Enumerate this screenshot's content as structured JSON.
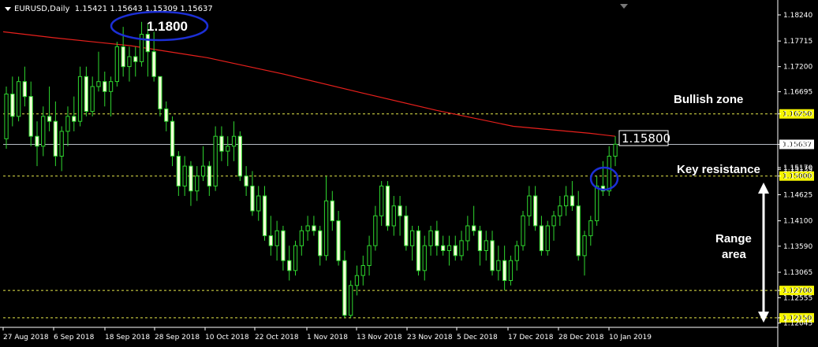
{
  "header": {
    "symbol_label": "EURUSD,Daily",
    "ohlc": "1.15421 1.15643 1.15309 1.15637"
  },
  "chart_data": {
    "type": "candlestick",
    "price_axis_ticks": [
      "1.18240",
      "1.17715",
      "1.17200",
      "1.16695",
      "1.16250",
      "1.15170",
      "1.15637",
      "1.15135",
      "1.15000",
      "1.14625",
      "1.14100",
      "1.13590",
      "1.13065",
      "1.12700",
      "1.12555",
      "1.12150",
      "1.12045"
    ],
    "date_ticks": [
      "27 Aug 2018",
      "6 Sep 2018",
      "18 Sep 2018",
      "28 Sep 2018",
      "10 Oct 2018",
      "22 Oct 2018",
      "1 Nov 2018",
      "13 Nov 2018",
      "23 Nov 2018",
      "5 Dec 2018",
      "17 Dec 2018",
      "28 Dec 2018",
      "10 Jan 2019"
    ],
    "ylim": [
      1.1199,
      1.1835
    ],
    "levels": [
      {
        "name": "bullish-zone-line",
        "value": 1.1625,
        "label": "1.16250"
      },
      {
        "name": "key-resistance-line",
        "value": 1.15,
        "label": "1.15000"
      },
      {
        "name": "range-top-line",
        "value": 1.127,
        "label": "1.12700"
      },
      {
        "name": "range-bottom-line",
        "value": 1.1215,
        "label": "1.12150"
      }
    ],
    "current_price": {
      "value": 1.15637,
      "label": "1.15637"
    },
    "moving_average": [
      [
        0,
        1.179
      ],
      [
        10,
        1.1778
      ],
      [
        25,
        1.1762
      ],
      [
        40,
        1.1738
      ],
      [
        55,
        1.1705
      ],
      [
        70,
        1.1668
      ],
      [
        85,
        1.1632
      ],
      [
        100,
        1.16
      ],
      [
        115,
        1.1586
      ],
      [
        120,
        1.158
      ]
    ],
    "candles": [
      [
        1.1575,
        1.168,
        1.1555,
        1.1665
      ],
      [
        1.1665,
        1.17,
        1.16,
        1.162
      ],
      [
        1.162,
        1.17,
        1.161,
        1.169
      ],
      [
        1.169,
        1.172,
        1.164,
        1.166
      ],
      [
        1.166,
        1.169,
        1.156,
        1.158
      ],
      [
        1.158,
        1.161,
        1.152,
        1.156
      ],
      [
        1.156,
        1.164,
        1.154,
        1.162
      ],
      [
        1.162,
        1.168,
        1.159,
        1.161
      ],
      [
        1.161,
        1.165,
        1.152,
        1.154
      ],
      [
        1.154,
        1.16,
        1.151,
        1.159
      ],
      [
        1.159,
        1.164,
        1.156,
        1.162
      ],
      [
        1.162,
        1.166,
        1.159,
        1.161
      ],
      [
        1.161,
        1.172,
        1.16,
        1.17
      ],
      [
        1.17,
        1.172,
        1.162,
        1.163
      ],
      [
        1.163,
        1.17,
        1.162,
        1.168
      ],
      [
        1.168,
        1.175,
        1.167,
        1.169
      ],
      [
        1.169,
        1.171,
        1.164,
        1.167
      ],
      [
        1.167,
        1.17,
        1.162,
        1.169
      ],
      [
        1.169,
        1.177,
        1.168,
        1.176
      ],
      [
        1.176,
        1.18,
        1.17,
        1.172
      ],
      [
        1.172,
        1.176,
        1.169,
        1.174
      ],
      [
        1.174,
        1.176,
        1.17,
        1.173
      ],
      [
        1.173,
        1.181,
        1.172,
        1.1785
      ],
      [
        1.1785,
        1.1805,
        1.17,
        1.175
      ],
      [
        1.175,
        1.179,
        1.169,
        1.17
      ],
      [
        1.17,
        1.17,
        1.162,
        1.1635
      ],
      [
        1.1635,
        1.165,
        1.159,
        1.161
      ],
      [
        1.161,
        1.162,
        1.152,
        1.154
      ],
      [
        1.154,
        1.155,
        1.146,
        1.148
      ],
      [
        1.148,
        1.154,
        1.146,
        1.152
      ],
      [
        1.152,
        1.153,
        1.144,
        1.147
      ],
      [
        1.147,
        1.152,
        1.145,
        1.15
      ],
      [
        1.15,
        1.156,
        1.149,
        1.152
      ],
      [
        1.152,
        1.153,
        1.146,
        1.148
      ],
      [
        1.148,
        1.16,
        1.147,
        1.158
      ],
      [
        1.158,
        1.16,
        1.153,
        1.155
      ],
      [
        1.155,
        1.158,
        1.152,
        1.156
      ],
      [
        1.156,
        1.161,
        1.153,
        1.158
      ],
      [
        1.158,
        1.159,
        1.149,
        1.15
      ],
      [
        1.15,
        1.152,
        1.146,
        1.148
      ],
      [
        1.148,
        1.151,
        1.142,
        1.143
      ],
      [
        1.143,
        1.148,
        1.141,
        1.146
      ],
      [
        1.146,
        1.148,
        1.137,
        1.138
      ],
      [
        1.138,
        1.142,
        1.134,
        1.136
      ],
      [
        1.136,
        1.141,
        1.133,
        1.139
      ],
      [
        1.139,
        1.14,
        1.131,
        1.133
      ],
      [
        1.133,
        1.136,
        1.129,
        1.131
      ],
      [
        1.131,
        1.137,
        1.13,
        1.136
      ],
      [
        1.136,
        1.14,
        1.134,
        1.139
      ],
      [
        1.139,
        1.142,
        1.137,
        1.14
      ],
      [
        1.14,
        1.142,
        1.138,
        1.139
      ],
      [
        1.139,
        1.14,
        1.132,
        1.134
      ],
      [
        1.134,
        1.15,
        1.133,
        1.145
      ],
      [
        1.145,
        1.147,
        1.139,
        1.141
      ],
      [
        1.141,
        1.143,
        1.132,
        1.133
      ],
      [
        1.133,
        1.135,
        1.1215,
        1.122
      ],
      [
        1.122,
        1.129,
        1.1215,
        1.128
      ],
      [
        1.128,
        1.132,
        1.126,
        1.13
      ],
      [
        1.13,
        1.134,
        1.128,
        1.132
      ],
      [
        1.132,
        1.138,
        1.13,
        1.136
      ],
      [
        1.136,
        1.144,
        1.135,
        1.142
      ],
      [
        1.142,
        1.149,
        1.14,
        1.148
      ],
      [
        1.148,
        1.149,
        1.139,
        1.14
      ],
      [
        1.14,
        1.146,
        1.138,
        1.144
      ],
      [
        1.144,
        1.146,
        1.138,
        1.142
      ],
      [
        1.142,
        1.144,
        1.135,
        1.136
      ],
      [
        1.136,
        1.14,
        1.133,
        1.139
      ],
      [
        1.139,
        1.14,
        1.13,
        1.131
      ],
      [
        1.131,
        1.138,
        1.129,
        1.136
      ],
      [
        1.136,
        1.14,
        1.134,
        1.139
      ],
      [
        1.139,
        1.141,
        1.134,
        1.136
      ],
      [
        1.136,
        1.138,
        1.134,
        1.135
      ],
      [
        1.135,
        1.138,
        1.132,
        1.136
      ],
      [
        1.136,
        1.138,
        1.133,
        1.134
      ],
      [
        1.134,
        1.139,
        1.133,
        1.137
      ],
      [
        1.137,
        1.142,
        1.135,
        1.14
      ],
      [
        1.14,
        1.144,
        1.138,
        1.139
      ],
      [
        1.139,
        1.14,
        1.132,
        1.135
      ],
      [
        1.135,
        1.139,
        1.133,
        1.137
      ],
      [
        1.137,
        1.139,
        1.13,
        1.131
      ],
      [
        1.131,
        1.136,
        1.129,
        1.133
      ],
      [
        1.133,
        1.136,
        1.127,
        1.129
      ],
      [
        1.129,
        1.134,
        1.128,
        1.133
      ],
      [
        1.133,
        1.137,
        1.131,
        1.136
      ],
      [
        1.136,
        1.143,
        1.135,
        1.142
      ],
      [
        1.142,
        1.148,
        1.14,
        1.146
      ],
      [
        1.146,
        1.148,
        1.139,
        1.14
      ],
      [
        1.14,
        1.142,
        1.134,
        1.135
      ],
      [
        1.135,
        1.141,
        1.134,
        1.14
      ],
      [
        1.14,
        1.143,
        1.137,
        1.142
      ],
      [
        1.142,
        1.146,
        1.14,
        1.144
      ],
      [
        1.144,
        1.148,
        1.142,
        1.146
      ],
      [
        1.146,
        1.149,
        1.143,
        1.144
      ],
      [
        1.144,
        1.147,
        1.133,
        1.134
      ],
      [
        1.134,
        1.139,
        1.13,
        1.138
      ],
      [
        1.138,
        1.142,
        1.136,
        1.141
      ],
      [
        1.141,
        1.15,
        1.14,
        1.148
      ],
      [
        1.148,
        1.153,
        1.146,
        1.147
      ],
      [
        1.147,
        1.156,
        1.146,
        1.154
      ],
      [
        1.154,
        1.158,
        1.152,
        1.1564
      ]
    ]
  },
  "annotations": {
    "peak_label": "1.1800",
    "price_box": "1.15800",
    "bullish_zone": "Bullish zone",
    "key_resistance": "Key resistance",
    "range_area_line1": "Range",
    "range_area_line2": "area"
  }
}
